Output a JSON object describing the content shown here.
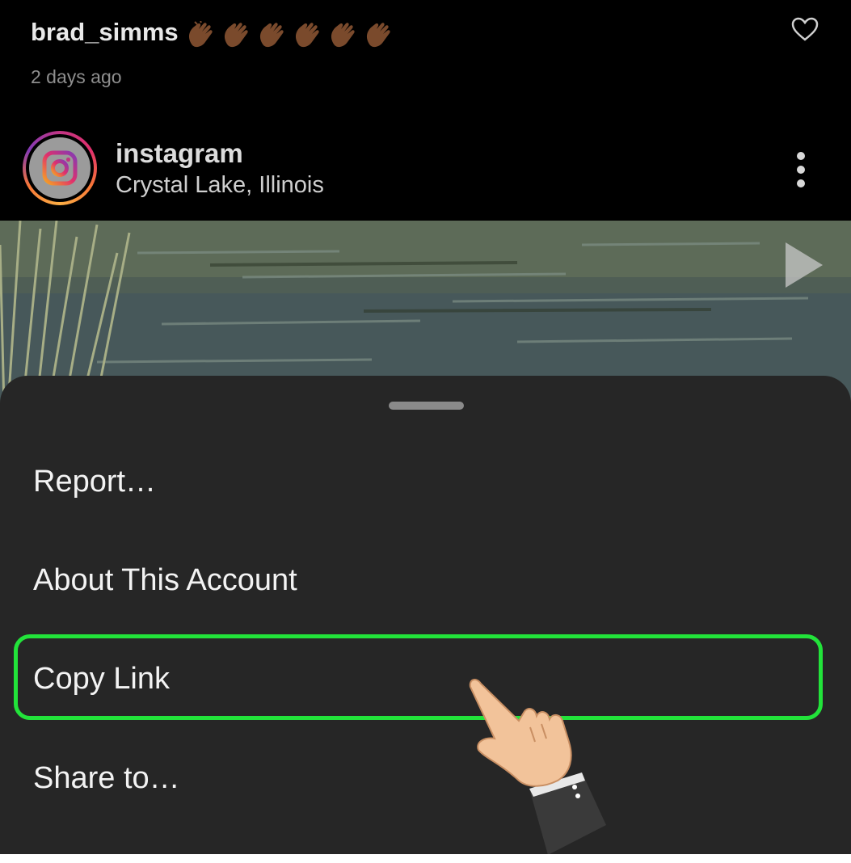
{
  "comment": {
    "username": "brad_simms",
    "emoji": [
      "clapping-hands-medium-dark",
      "clapping-hands-medium-dark",
      "clapping-hands-medium-dark",
      "clapping-hands-medium-dark",
      "clapping-hands-medium-dark",
      "clapping-hands-medium-dark"
    ],
    "time": "2 days ago",
    "like_icon": "heart-outline-icon"
  },
  "post": {
    "username": "instagram",
    "location": "Crystal Lake, Illinois",
    "avatar_icon": "instagram-logo-icon",
    "more_icon": "vertical-ellipsis-icon",
    "media_icon": "play-icon"
  },
  "sheet": {
    "items": [
      {
        "label": "Report…"
      },
      {
        "label": "About This Account"
      },
      {
        "label": "Copy Link"
      },
      {
        "label": "Share to…"
      }
    ],
    "highlighted_item": "Copy Link"
  },
  "colors": {
    "background": "#000000",
    "sheet": "#262626",
    "highlight": "#22e33a",
    "text": "#f3f3f3"
  }
}
